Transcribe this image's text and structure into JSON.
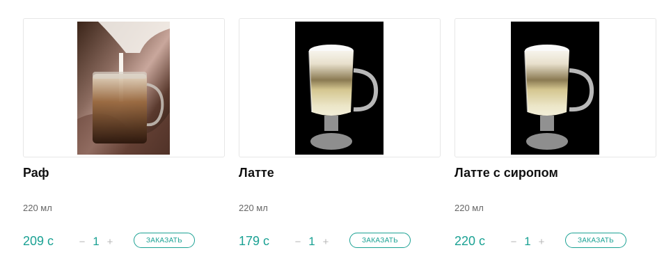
{
  "products": [
    {
      "name": "Раф",
      "volume": "220 мл",
      "price": "209 с",
      "quantity": "1",
      "minus": "−",
      "plus": "+",
      "order_label": "ЗАКАЗАТЬ",
      "image_alt": "raf coffee photo"
    },
    {
      "name": "Латте",
      "volume": "220 мл",
      "price": "179 с",
      "quantity": "1",
      "minus": "−",
      "plus": "+",
      "order_label": "ЗАКАЗАТЬ",
      "image_alt": "latte glass photo"
    },
    {
      "name": "Латте с сиропом",
      "volume": "220 мл",
      "price": "220 с",
      "quantity": "1",
      "minus": "−",
      "plus": "+",
      "order_label": "ЗАКАЗАТЬ",
      "image_alt": "latte with syrup glass photo"
    }
  ],
  "colors": {
    "accent": "#1aa193",
    "title": "#111111",
    "muted": "#666666",
    "border": "#e6e6e6"
  }
}
